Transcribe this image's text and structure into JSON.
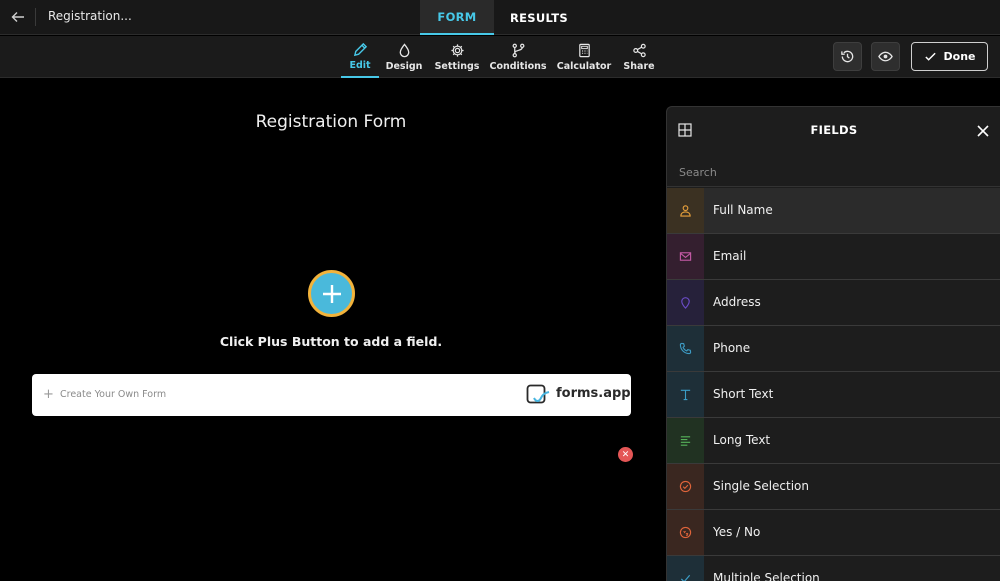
{
  "topbar": {
    "form_title": "Registration...",
    "tabs": [
      {
        "label": "FORM"
      },
      {
        "label": "RESULTS"
      }
    ]
  },
  "toolbar": {
    "tools": [
      {
        "label": "Edit",
        "icon": "pencil-icon"
      },
      {
        "label": "Design",
        "icon": "drop-icon"
      },
      {
        "label": "Settings",
        "icon": "gear-icon"
      },
      {
        "label": "Conditions",
        "icon": "branch-icon"
      },
      {
        "label": "Calculator",
        "icon": "calculator-icon"
      },
      {
        "label": "Share",
        "icon": "share-icon"
      }
    ],
    "done_label": "Done"
  },
  "canvas": {
    "form_title": "Registration Form",
    "hint": "Click Plus Button to add a field."
  },
  "banner": {
    "text": "Create Your Own Form",
    "brand": "forms.app"
  },
  "panel": {
    "title": "FIELDS",
    "search_placeholder": "Search",
    "fields": [
      {
        "label": "Full Name",
        "icon": "person-icon",
        "color": "#e9a13b",
        "bg": "#3b3122"
      },
      {
        "label": "Email",
        "icon": "envelope-icon",
        "color": "#c45aa6",
        "bg": "#341f2f"
      },
      {
        "label": "Address",
        "icon": "pin-icon",
        "color": "#6a4bc6",
        "bg": "#26213a"
      },
      {
        "label": "Phone",
        "icon": "phone-icon",
        "color": "#3d9bc4",
        "bg": "#1e2f38"
      },
      {
        "label": "Short Text",
        "icon": "text-icon",
        "color": "#3b9ec7",
        "bg": "#1e2f38"
      },
      {
        "label": "Long Text",
        "icon": "lines-icon",
        "color": "#56b25a",
        "bg": "#213222"
      },
      {
        "label": "Single Selection",
        "icon": "check-circle-icon",
        "color": "#e0643a",
        "bg": "#3a2720"
      },
      {
        "label": "Yes / No",
        "icon": "yes-no-icon",
        "color": "#e0643a",
        "bg": "#3a2720"
      },
      {
        "label": "Multiple Selection",
        "icon": "check-icon",
        "color": "#3b9ec7",
        "bg": "#1e2f38"
      }
    ]
  }
}
